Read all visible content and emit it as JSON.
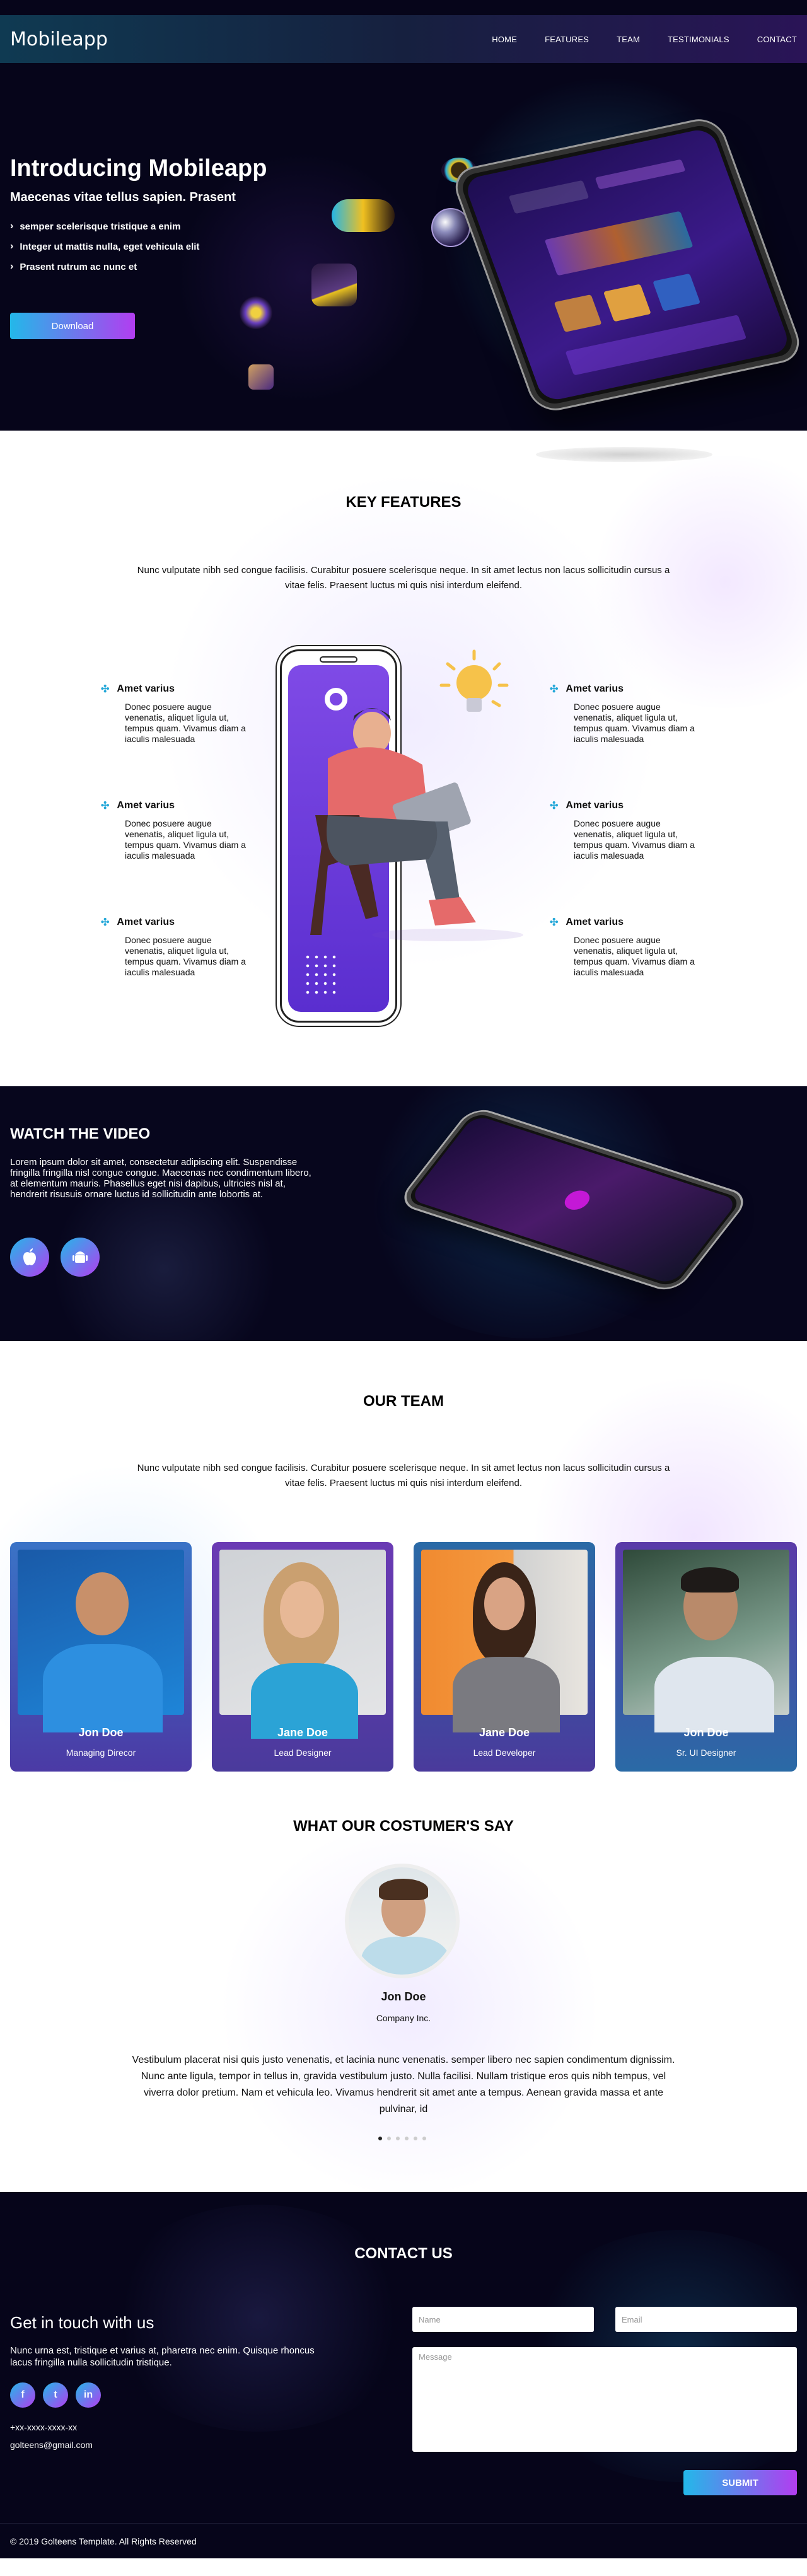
{
  "brand": {
    "logo": "Mobileapp",
    "accent_start": "#23b8e9",
    "accent_end": "#b23df0"
  },
  "nav": {
    "items": [
      "HOME",
      "FEATURES",
      "TEAM",
      "TESTIMONIALS",
      "CONTACT"
    ]
  },
  "hero": {
    "title": "Introducing Mobileapp",
    "subtitle": "Maecenas vitae tellus sapien. Prasent",
    "bullets": [
      "semper scelerisque tristique a enim",
      "Integer ut mattis nulla, eget vehicula elit",
      "Prasent rutrum ac nunc et"
    ],
    "button": "Download"
  },
  "features": {
    "title": "KEY FEATURES",
    "description": "Nunc vulputate nibh sed congue facilisis. Curabitur posuere scelerisque neque. In sit amet lectus non lacus sollicitudin cursus a vitae felis. Praesent luctus mi quis nisi interdum eleifend.",
    "items": [
      {
        "title": "Amet varius",
        "text": "Donec posuere augue venenatis, aliquet ligula ut, tempus quam. Vivamus  diam a iaculis malesuada"
      },
      {
        "title": "Amet varius",
        "text": "Donec posuere augue venenatis, aliquet ligula ut, tempus quam. Vivamus  diam a iaculis malesuada"
      },
      {
        "title": "Amet varius",
        "text": "Donec posuere augue venenatis, aliquet ligula ut, tempus quam. Vivamus    diam a iaculis malesuada"
      },
      {
        "title": "Amet varius",
        "text": "Donec posuere augue venenatis, aliquet ligula ut, tempus quam. Vivamus  diam a iaculis malesuada"
      },
      {
        "title": "Amet varius",
        "text": "Donec posuere augue venenatis, aliquet ligula ut, tempus quam. Vivamus  diam a iaculis malesuada"
      },
      {
        "title": "Amet varius",
        "text": "Donec posuere augue venenatis, aliquet ligula ut, tempus quam. Vivamus     diam a iaculis malesuada"
      }
    ]
  },
  "video": {
    "title": "WATCH THE VIDEO",
    "text": "Lorem ipsum dolor sit amet, consectetur adipiscing elit. Suspendisse fringilla fringilla nisl congue congue. Maecenas nec condimentum libero, at elementum mauris. Phasellus eget nisi dapibus, ultricies nisl at, hendrerit risusuis ornare luctus id sollicitudin ante lobortis at.",
    "store_icons": [
      "apple-icon",
      "android-icon"
    ]
  },
  "team": {
    "title": "OUR TEAM",
    "description": "Nunc vulputate nibh sed congue facilisis. Curabitur posuere scelerisque neque. In sit amet lectus non lacus sollicitudin cursus a vitae felis. Praesent luctus mi quis nisi interdum eleifend.",
    "members": [
      {
        "name": "Jon Doe",
        "role": "Managing Direcor"
      },
      {
        "name": "Jane Doe",
        "role": "Lead Designer"
      },
      {
        "name": "Jane Doe",
        "role": "Lead Developer"
      },
      {
        "name": "Jon Doe",
        "role": "Sr. UI Designer"
      }
    ]
  },
  "testimonials": {
    "title": "WHAT OUR COSTUMER'S SAY",
    "name": "Jon Doe",
    "company": "Company Inc.",
    "text": "Vestibulum placerat nisi quis justo venenatis, et lacinia nunc venenatis. semper libero nec sapien condimentum dignissim. Nunc ante ligula, tempor in tellus in, gravida vestibulum justo. Nulla facilisi. Nullam tristique eros quis nibh tempus, vel viverra dolor pretium. Nam et vehicula leo. Vivamus hendrerit sit amet ante a tempus. Aenean gravida massa et ante pulvinar, id",
    "active_dot": 1,
    "dot_count": 6
  },
  "contact": {
    "title": "CONTACT US",
    "heading": "Get in touch with us",
    "text": "Nunc urna est, tristique et varius at, pharetra nec enim. Quisque rhoncus lacus fringilla nulla sollicitudin tristique.",
    "social": [
      "f",
      "t",
      "in"
    ],
    "phone": "+xx-xxxx-xxxx-xx",
    "email": "golteens@gmail.com",
    "form": {
      "name_placeholder": "Name",
      "email_placeholder": "Email",
      "message_placeholder": "Message",
      "submit": "SUBMIT"
    }
  },
  "footer": {
    "copyright": "© 2019 Golteens Template. All Rights Reserved"
  }
}
